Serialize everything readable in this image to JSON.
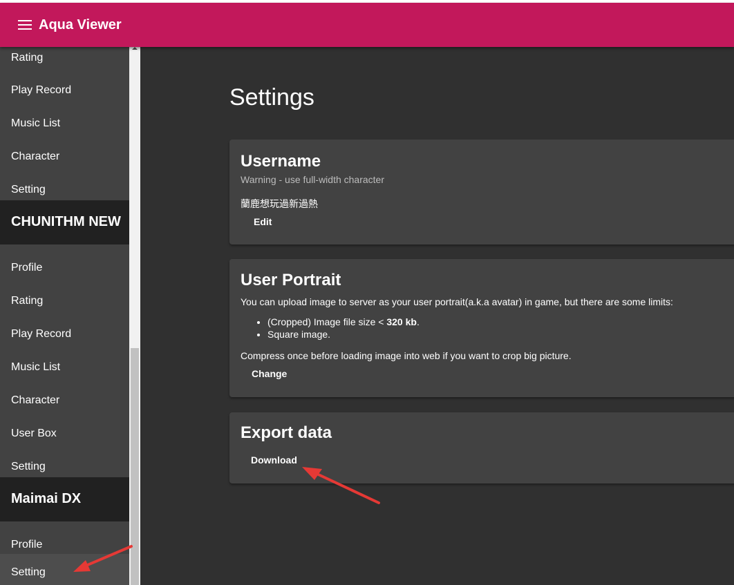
{
  "app": {
    "title": "Aqua Viewer",
    "accent_color": "#c2185b",
    "menu_icon": "menu-icon"
  },
  "sidebar": {
    "top_items": [
      "Rating",
      "Play Record",
      "Music List",
      "Character",
      "Setting"
    ],
    "sections": [
      {
        "title": "CHUNITHM NEW",
        "items": [
          "Profile",
          "Rating",
          "Play Record",
          "Music List",
          "Character",
          "User Box",
          "Setting"
        ]
      },
      {
        "title": "Maimai DX",
        "items": [
          "Profile",
          "Setting"
        ],
        "active_item": "Setting"
      }
    ]
  },
  "main": {
    "title": "Settings",
    "username_card": {
      "title": "Username",
      "subtitle": "Warning - use full-width character",
      "value": "蘭鹿想玩過新過熱",
      "button": "Edit"
    },
    "portrait_card": {
      "title": "User Portrait",
      "description": "You can upload image to server as your user portrait(a.k.a avatar) in game, but there are some limits:",
      "limit_1_prefix": "(Cropped) Image file size < ",
      "limit_1_value": "320 kb",
      "limit_1_suffix": ".",
      "limit_2": "Square image.",
      "note": "Compress once before loading image into web if you want to crop big picture.",
      "button": "Change"
    },
    "export_card": {
      "title": "Export data",
      "button": "Download"
    }
  },
  "annotation_color": "#e53935"
}
